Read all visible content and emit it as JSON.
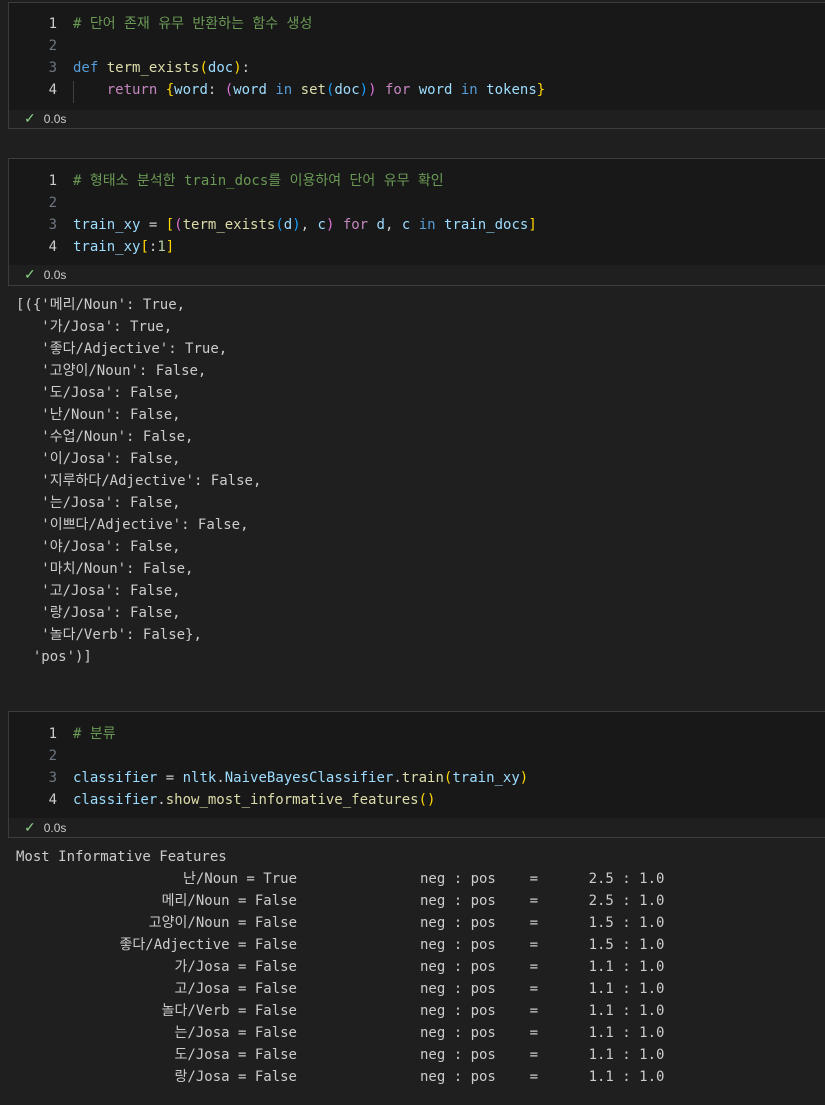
{
  "cells": [
    {
      "lines": [
        {
          "n": "1",
          "parts": [
            [
              "cm",
              "# 단어 존재 유무 반환하는 함수 생성"
            ]
          ]
        },
        {
          "n": "2",
          "parts": []
        },
        {
          "n": "3",
          "parts": [
            [
              "kw",
              "def"
            ],
            [
              "",
              " "
            ],
            [
              "fn",
              "term_exists"
            ],
            [
              "br1",
              "("
            ],
            [
              "var",
              "doc"
            ],
            [
              "br1",
              ")"
            ],
            [
              "",
              ":"
            ]
          ]
        },
        {
          "n": "4",
          "parts": [
            [
              "",
              "    "
            ],
            [
              "ctl",
              "return"
            ],
            [
              "",
              " "
            ],
            [
              "br1",
              "{"
            ],
            [
              "var",
              "word"
            ],
            [
              "",
              ": "
            ],
            [
              "br2",
              "("
            ],
            [
              "var",
              "word"
            ],
            [
              "",
              " "
            ],
            [
              "kw",
              "in"
            ],
            [
              "",
              " "
            ],
            [
              "fn",
              "set"
            ],
            [
              "br3",
              "("
            ],
            [
              "var",
              "doc"
            ],
            [
              "br3",
              ")"
            ],
            [
              "br2",
              ")"
            ],
            [
              "",
              " "
            ],
            [
              "ctl",
              "for"
            ],
            [
              "",
              " "
            ],
            [
              "var",
              "word"
            ],
            [
              "",
              " "
            ],
            [
              "kw",
              "in"
            ],
            [
              "",
              " "
            ],
            [
              "var",
              "tokens"
            ],
            [
              "br1",
              "}"
            ]
          ]
        }
      ],
      "status_time": "0.0s"
    },
    {
      "lines": [
        {
          "n": "1",
          "parts": [
            [
              "cm",
              "# 형태소 분석한 train_docs를 이용하여 단어 유무 확인"
            ]
          ]
        },
        {
          "n": "2",
          "parts": []
        },
        {
          "n": "3",
          "parts": [
            [
              "var",
              "train_xy"
            ],
            [
              "",
              " = "
            ],
            [
              "br1",
              "["
            ],
            [
              "br2",
              "("
            ],
            [
              "fn",
              "term_exists"
            ],
            [
              "br3",
              "("
            ],
            [
              "var",
              "d"
            ],
            [
              "br3",
              ")"
            ],
            [
              "",
              ", "
            ],
            [
              "var",
              "c"
            ],
            [
              "br2",
              ")"
            ],
            [
              "",
              " "
            ],
            [
              "ctl",
              "for"
            ],
            [
              "",
              " "
            ],
            [
              "var",
              "d"
            ],
            [
              "",
              ", "
            ],
            [
              "var",
              "c"
            ],
            [
              "",
              " "
            ],
            [
              "kw",
              "in"
            ],
            [
              "",
              " "
            ],
            [
              "var",
              "train_docs"
            ],
            [
              "br1",
              "]"
            ]
          ]
        },
        {
          "n": "4",
          "parts": [
            [
              "var",
              "train_xy"
            ],
            [
              "br1",
              "["
            ],
            [
              "",
              ":"
            ],
            [
              "num",
              "1"
            ],
            [
              "br1",
              "]"
            ]
          ]
        }
      ],
      "status_time": "0.0s",
      "output": "[({'메리/Noun': True,\n   '가/Josa': True,\n   '좋다/Adjective': True,\n   '고양이/Noun': False,\n   '도/Josa': False,\n   '난/Noun': False,\n   '수업/Noun': False,\n   '이/Josa': False,\n   '지루하다/Adjective': False,\n   '는/Josa': False,\n   '이쁘다/Adjective': False,\n   '야/Josa': False,\n   '마치/Noun': False,\n   '고/Josa': False,\n   '랑/Josa': False,\n   '놀다/Verb': False},\n  'pos')]"
    },
    {
      "lines": [
        {
          "n": "1",
          "parts": [
            [
              "cm",
              "# 분류"
            ]
          ]
        },
        {
          "n": "2",
          "parts": []
        },
        {
          "n": "3",
          "parts": [
            [
              "var",
              "classifier"
            ],
            [
              "",
              " = "
            ],
            [
              "var",
              "nltk"
            ],
            [
              "",
              "."
            ],
            [
              "var",
              "NaiveBayesClassifier"
            ],
            [
              "",
              "."
            ],
            [
              "fn",
              "train"
            ],
            [
              "br1",
              "("
            ],
            [
              "var",
              "train_xy"
            ],
            [
              "br1",
              ")"
            ]
          ]
        },
        {
          "n": "4",
          "parts": [
            [
              "var",
              "classifier"
            ],
            [
              "",
              "."
            ],
            [
              "fn",
              "show_most_informative_features"
            ],
            [
              "br1",
              "()"
            ]
          ]
        }
      ],
      "status_time": "0.0s",
      "output_header": "Most Informative Features",
      "features": [
        {
          "feat": "난/Noun = True",
          "ratio": "neg : pos    =      2.5 : 1.0"
        },
        {
          "feat": "메리/Noun = False",
          "ratio": "neg : pos    =      2.5 : 1.0"
        },
        {
          "feat": "고양이/Noun = False",
          "ratio": "neg : pos    =      1.5 : 1.0"
        },
        {
          "feat": "좋다/Adjective = False",
          "ratio": "neg : pos    =      1.5 : 1.0"
        },
        {
          "feat": "가/Josa = False",
          "ratio": "neg : pos    =      1.1 : 1.0"
        },
        {
          "feat": "고/Josa = False",
          "ratio": "neg : pos    =      1.1 : 1.0"
        },
        {
          "feat": "놀다/Verb = False",
          "ratio": "neg : pos    =      1.1 : 1.0"
        },
        {
          "feat": "는/Josa = False",
          "ratio": "neg : pos    =      1.1 : 1.0"
        },
        {
          "feat": "도/Josa = False",
          "ratio": "neg : pos    =      1.1 : 1.0"
        },
        {
          "feat": "랑/Josa = False",
          "ratio": "neg : pos    =      1.1 : 1.0"
        }
      ]
    }
  ]
}
